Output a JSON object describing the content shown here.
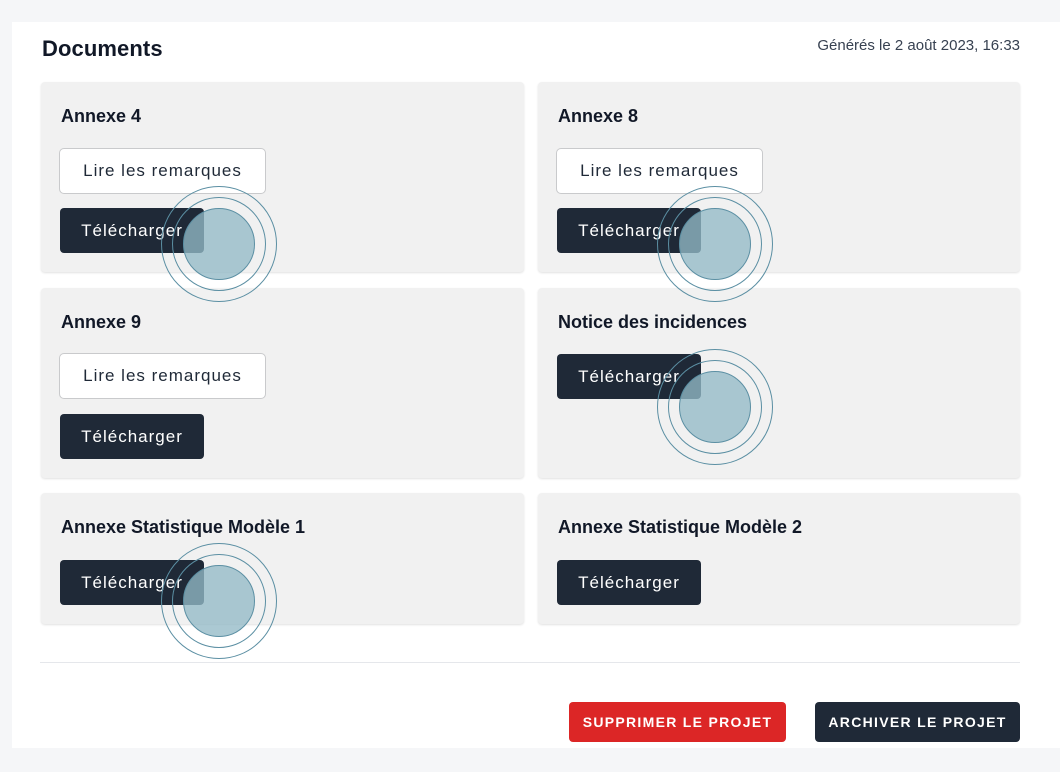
{
  "header": {
    "title": "Documents",
    "generated": "Générés le 2 août 2023, 16:33"
  },
  "cards": [
    {
      "title": "Annexe 4",
      "remarks_label": "Lire les remarques",
      "download_label": "Télécharger"
    },
    {
      "title": "Annexe 8",
      "remarks_label": "Lire les remarques",
      "download_label": "Télécharger"
    },
    {
      "title": "Annexe 9",
      "remarks_label": "Lire les remarques",
      "download_label": "Télécharger"
    },
    {
      "title": "Notice des incidences",
      "download_label": "Télécharger"
    },
    {
      "title": "Annexe Statistique Modèle 1",
      "download_label": "Télécharger"
    },
    {
      "title": "Annexe Statistique Modèle 2",
      "download_label": "Télécharger"
    }
  ],
  "footer": {
    "delete_label": "SUPPRIMER LE PROJET",
    "archive_label": "ARCHIVER LE PROJET"
  },
  "colors": {
    "danger": "#dc2626",
    "primary_dark": "#1f2937",
    "card_bg": "#f1f1f1",
    "click_marker": "#93bac6"
  }
}
